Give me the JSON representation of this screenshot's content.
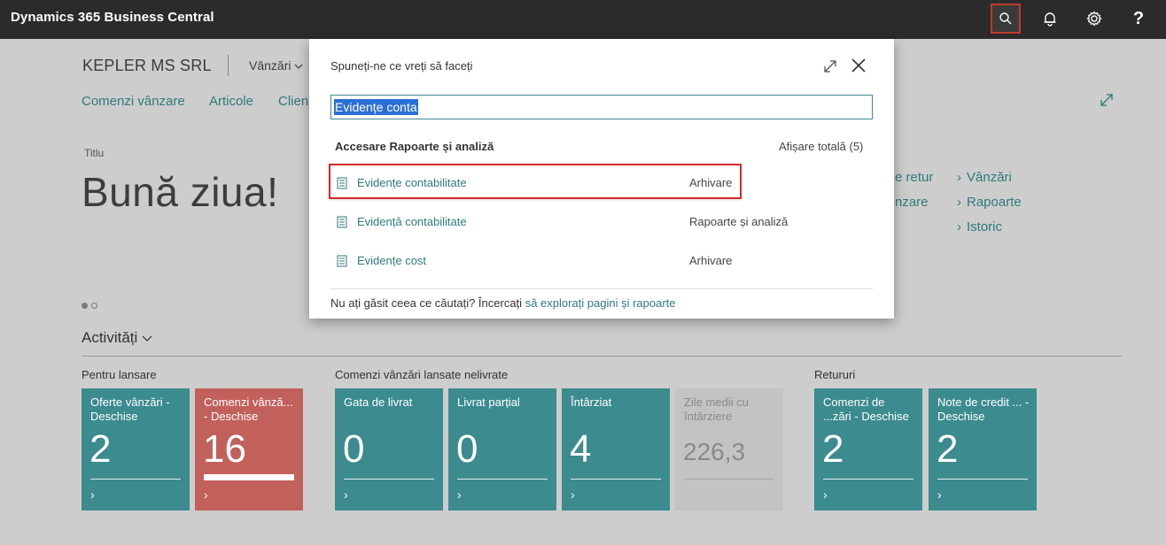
{
  "app": {
    "title": "Dynamics 365 Business Central",
    "help_label": "?"
  },
  "page": {
    "company": "KEPLER MS SRL",
    "role_menu": "Vânzări",
    "nav": [
      "Comenzi vânzare",
      "Articole",
      "Clien"
    ],
    "headline_label": "Titlu",
    "headline": "Bună ziua!",
    "side_links_left": [
      "e retur",
      "nzare"
    ],
    "side_links_right": [
      "Vânzări",
      "Rapoarte",
      "Istoric"
    ],
    "activities_title": "Activități",
    "groups": [
      "Pentru lansare",
      "Comenzi vânzări lansate nelivrate",
      "Retururi"
    ],
    "tiles": [
      {
        "label": "Oferte vânzări - Deschise",
        "value": "2",
        "style": "teal"
      },
      {
        "label": "Comenzi vânză... - Deschise",
        "value": "16",
        "style": "red"
      },
      {
        "label": "Gata de livrat",
        "value": "0",
        "style": "teal"
      },
      {
        "label": "Livrat parțial",
        "value": "0",
        "style": "teal"
      },
      {
        "label": "Întârziat",
        "value": "4",
        "style": "teal"
      },
      {
        "label": "Zile medii cu întârziere",
        "value": "226,3",
        "style": "gray"
      },
      {
        "label": "Comenzi de ...zări - Deschise",
        "value": "2",
        "style": "teal"
      },
      {
        "label": "Note de credit ... - Deschise",
        "value": "2",
        "style": "teal"
      }
    ]
  },
  "dialog": {
    "title": "Spuneți-ne ce vreți să faceți",
    "search_value": "Evidențe conta",
    "section_heading": "Accesare Rapoarte și analiză",
    "show_all": "Afișare totală (5)",
    "results": [
      {
        "name": "Evidențe contabilitate",
        "category": "Arhivare"
      },
      {
        "name": "Evidență contabilitate",
        "category": "Rapoarte și analiză"
      },
      {
        "name": "Evidențe cost",
        "category": "Arhivare"
      }
    ],
    "footer_text": "Nu ați găsit ceea ce căutați? Încercați",
    "footer_link": "să explorați pagini și rapoarte"
  },
  "colors": {
    "topbar": "#2b2b2b",
    "accent_teal": "#3b8b8f",
    "tile_red": "#c2605c",
    "highlight_border": "#d22b2b",
    "selection": "#2a6fd6"
  }
}
